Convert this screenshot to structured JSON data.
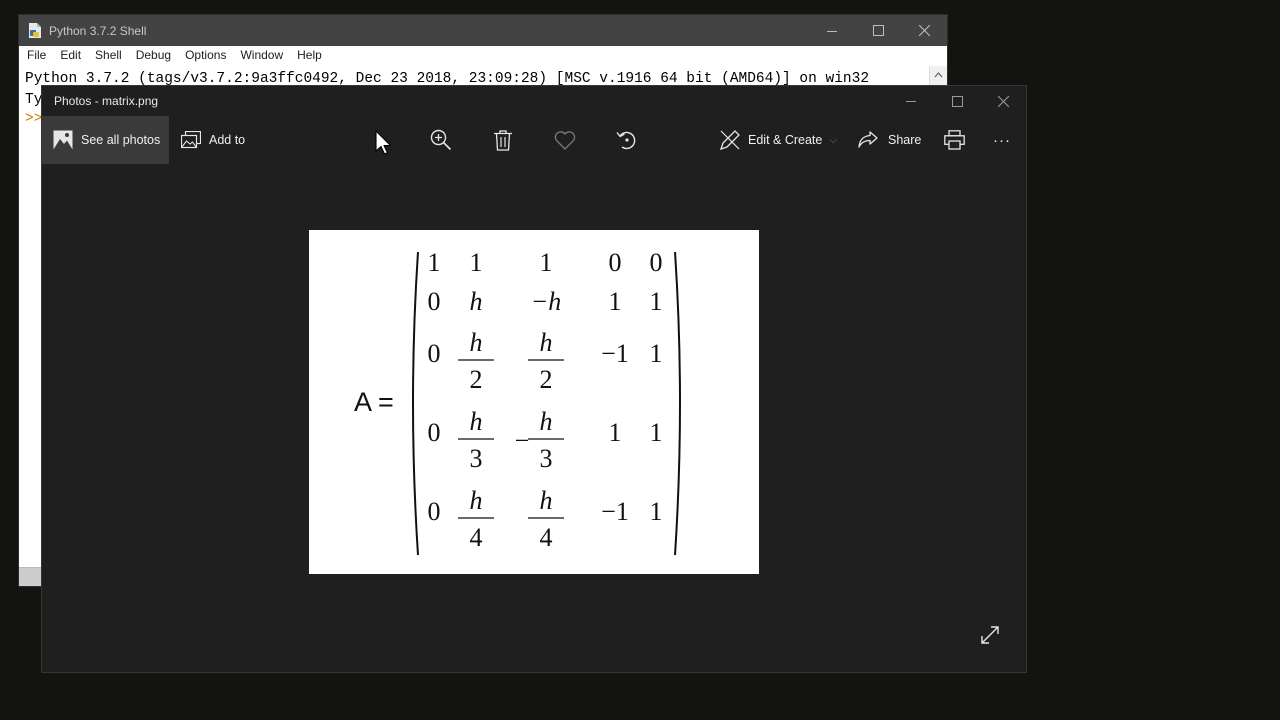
{
  "shell": {
    "title": "Python 3.7.2 Shell",
    "menu": [
      "File",
      "Edit",
      "Shell",
      "Debug",
      "Options",
      "Window",
      "Help"
    ],
    "line1": "Python 3.7.2 (tags/v3.7.2:9a3ffc0492, Dec 23 2018, 23:09:28) [MSC v.1916 64 bit (AMD64)] on win32",
    "line2_visible": "Ty",
    "prompt_visible": ">>"
  },
  "photos": {
    "title": "Photos - matrix.png",
    "toolbar": {
      "see_all": "See all photos",
      "add_to": "Add to",
      "edit_create": "Edit & Create",
      "share": "Share",
      "more": "···"
    },
    "icons": {
      "zoom": "zoom-in-icon",
      "delete": "trash-icon",
      "favorite": "heart-icon",
      "rotate": "rotate-icon",
      "print": "printer-icon",
      "expand": "expand-icon"
    }
  },
  "image": {
    "lhs": "A =",
    "matrix": [
      [
        {
          "t": "1"
        },
        {
          "t": "1"
        },
        {
          "t": "1"
        },
        {
          "t": "0"
        },
        {
          "t": "0"
        }
      ],
      [
        {
          "t": "0"
        },
        {
          "t": "h"
        },
        {
          "t": "−h"
        },
        {
          "t": "1"
        },
        {
          "t": "1"
        }
      ],
      [
        {
          "t": "0"
        },
        {
          "n": "h",
          "d": "2"
        },
        {
          "n": "h",
          "d": "2"
        },
        {
          "t": "−1"
        },
        {
          "t": "1"
        }
      ],
      [
        {
          "t": "0"
        },
        {
          "n": "h",
          "d": "3"
        },
        {
          "n": "h",
          "d": "3",
          "neg": true
        },
        {
          "t": "1"
        },
        {
          "t": "1"
        }
      ],
      [
        {
          "t": "0"
        },
        {
          "n": "h",
          "d": "4"
        },
        {
          "n": "h",
          "d": "4"
        },
        {
          "t": "−1"
        },
        {
          "t": "1"
        }
      ]
    ]
  },
  "colors": {
    "desktop": "#131310",
    "photos_bg": "#1f1f1f",
    "shell_title": "#434343",
    "prompt": "#c97d00"
  }
}
